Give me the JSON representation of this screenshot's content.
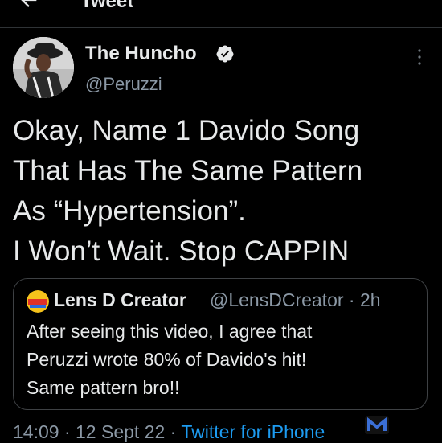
{
  "header": {
    "title": "Tweet",
    "back_icon": "arrow-left-icon"
  },
  "author": {
    "name": "The Huncho",
    "handle": "@Peruzzi",
    "verified_icon": "verified-badge-icon",
    "avatar": "avatar"
  },
  "tweet": {
    "lines": [
      "Okay, Name 1 Davido Song",
      "That Has The Same Pattern",
      "As “Hypertension”.",
      "I Won’t Wait. Stop CAPPIN"
    ]
  },
  "quote": {
    "name": "Lens D Creator",
    "handle_time": "@LensDCreator · 2h",
    "lines": [
      "After seeing this video, I agree that",
      "Peruzzi wrote 80% of Davido's hit!",
      "Same pattern bro!!"
    ]
  },
  "meta": {
    "time": "14:09",
    "date": "12 Sept 22",
    "source": "Twitter for iPhone",
    "separator": " · "
  },
  "colors": {
    "background": "#000000",
    "text": "#e7e9ea",
    "secondary": "#8b98a5",
    "accent": "#1d9bf0",
    "border": "#2f3336"
  }
}
